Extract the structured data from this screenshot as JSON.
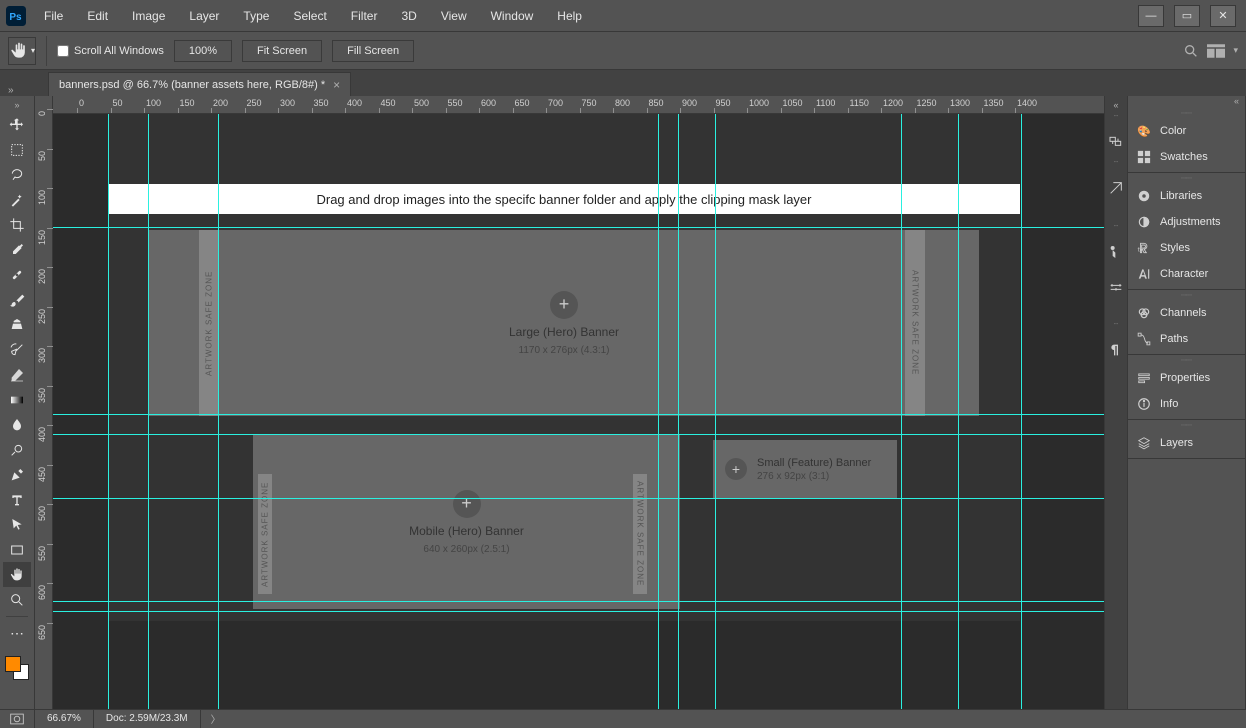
{
  "menu": [
    "File",
    "Edit",
    "Image",
    "Layer",
    "Type",
    "Select",
    "Filter",
    "3D",
    "View",
    "Window",
    "Help"
  ],
  "options": {
    "scroll_all": "Scroll All Windows",
    "zoom": "100%",
    "fit": "Fit Screen",
    "fill": "Fill Screen"
  },
  "doc_tab": "banners.psd @ 66.7% (banner assets here, RGB/8#) *",
  "ruler_ticks": [
    0,
    50,
    100,
    150,
    200,
    250,
    300,
    350,
    400,
    450,
    500,
    550,
    600,
    650,
    700,
    750,
    800,
    850,
    900,
    950,
    1000,
    1050,
    1100,
    1150,
    1200,
    1250,
    1300,
    1350,
    1400
  ],
  "ruler_v": [
    0,
    50,
    100,
    150,
    200,
    250,
    300,
    350,
    400,
    450,
    500,
    550,
    600,
    650
  ],
  "canvas": {
    "instr": "Drag and drop images into the specifc banner folder and apply the clipping mask layer",
    "safezone": "ARTWORK SAFE ZONE",
    "large": {
      "title": "Large (Hero) Banner",
      "dim": "1170 x 276px (4.3:1)"
    },
    "mobile": {
      "title": "Mobile (Hero) Banner",
      "dim": "640 x 260px (2.5:1)"
    },
    "small": {
      "title": "Small (Feature) Banner",
      "dim": "276 x 92px (3:1)"
    }
  },
  "panels": {
    "color": "Color",
    "swatches": "Swatches",
    "libraries": "Libraries",
    "adjustments": "Adjustments",
    "styles": "Styles",
    "character": "Character",
    "channels": "Channels",
    "paths": "Paths",
    "properties": "Properties",
    "info": "Info",
    "layers": "Layers"
  },
  "status": {
    "zoom": "66.67%",
    "doc": "Doc: 2.59M/23.3M"
  }
}
